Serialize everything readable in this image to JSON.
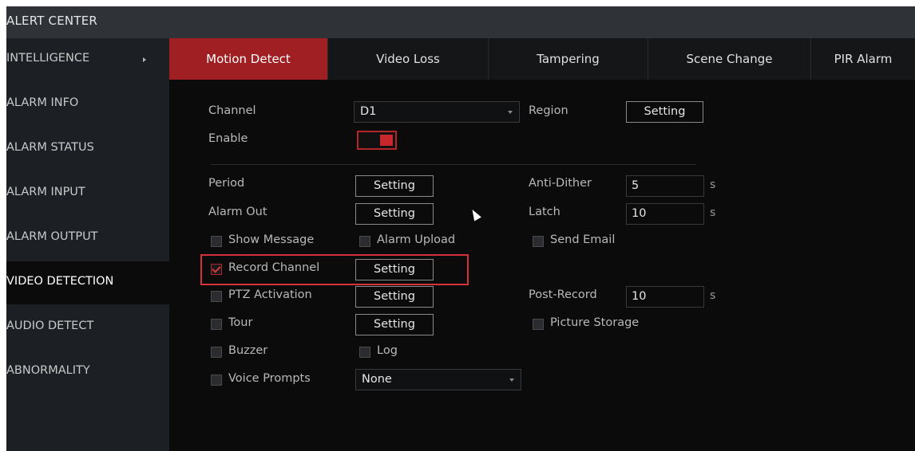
{
  "window": {
    "title": "ALERT CENTER"
  },
  "sidebar": {
    "items": [
      {
        "label": "INTELLIGENCE",
        "has_arrow": true
      },
      {
        "label": "ALARM INFO"
      },
      {
        "label": "ALARM STATUS"
      },
      {
        "label": "ALARM INPUT"
      },
      {
        "label": "ALARM OUTPUT"
      },
      {
        "label": "VIDEO DETECTION",
        "active": true
      },
      {
        "label": "AUDIO DETECT"
      },
      {
        "label": "ABNORMALITY"
      }
    ]
  },
  "tabs": [
    {
      "label": "Motion Detect",
      "active": true
    },
    {
      "label": "Video Loss"
    },
    {
      "label": "Tampering"
    },
    {
      "label": "Scene Change"
    },
    {
      "label": "PIR Alarm"
    }
  ],
  "form": {
    "channel": {
      "label": "Channel",
      "value": "D1"
    },
    "region": {
      "label": "Region",
      "button": "Setting"
    },
    "enable": {
      "label": "Enable",
      "on": true
    },
    "period": {
      "label": "Period",
      "button": "Setting"
    },
    "anti_dither": {
      "label": "Anti-Dither",
      "value": "5",
      "unit": "s"
    },
    "alarm_out": {
      "label": "Alarm Out",
      "button": "Setting"
    },
    "latch": {
      "label": "Latch",
      "value": "10",
      "unit": "s"
    },
    "show_message": {
      "label": "Show Message",
      "checked": false
    },
    "alarm_upload": {
      "label": "Alarm Upload",
      "checked": false
    },
    "send_email": {
      "label": "Send Email",
      "checked": false
    },
    "record_channel": {
      "label": "Record Channel",
      "checked": true,
      "button": "Setting"
    },
    "ptz_activation": {
      "label": "PTZ Activation",
      "checked": false,
      "button": "Setting"
    },
    "post_record": {
      "label": "Post-Record",
      "value": "10",
      "unit": "s"
    },
    "tour": {
      "label": "Tour",
      "checked": false,
      "button": "Setting"
    },
    "picture_storage": {
      "label": "Picture Storage",
      "checked": false
    },
    "buzzer": {
      "label": "Buzzer",
      "checked": false
    },
    "log": {
      "label": "Log",
      "checked": false
    },
    "voice_prompts": {
      "label": "Voice Prompts",
      "checked": false,
      "value": "None"
    }
  },
  "colors": {
    "accent": "#9f1f22",
    "highlight_box": "#d6323a",
    "background": "#0b0b0b",
    "sidebar": "#1c1f23",
    "titlebar": "#2f3338"
  }
}
